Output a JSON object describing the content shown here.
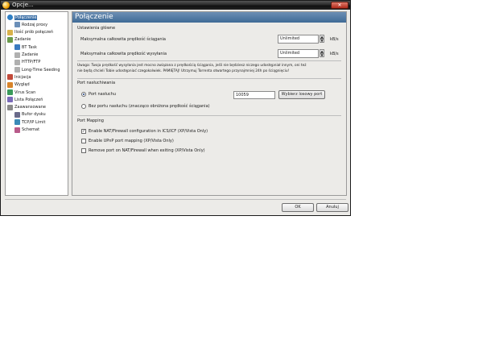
{
  "window": {
    "title": "Opcje...",
    "close_glyph": "✕"
  },
  "sidebar": {
    "items": [
      {
        "label": "Połączenie",
        "icon": "globe-icon",
        "indent": 0,
        "selected": true
      },
      {
        "label": "Rodzaj proxy",
        "icon": "proxy-icon",
        "indent": 1
      },
      {
        "label": "Ilość prób połączeń",
        "icon": "folder-icon",
        "indent": 0
      },
      {
        "label": "Zadanie",
        "icon": "task-icon",
        "indent": 0
      },
      {
        "label": "BT Task",
        "icon": "bt-task-icon",
        "indent": 1
      },
      {
        "label": "Zadanie",
        "icon": "page-icon",
        "indent": 1
      },
      {
        "label": "HTTP/FTP",
        "icon": "page-icon",
        "indent": 1
      },
      {
        "label": "Long-Time Seeding",
        "icon": "page-icon",
        "indent": 1
      },
      {
        "label": "Inicjacja",
        "icon": "init-icon",
        "indent": 0
      },
      {
        "label": "Wygląd",
        "icon": "appearance-icon",
        "indent": 0
      },
      {
        "label": "Virus Scan",
        "icon": "shield-icon",
        "indent": 0
      },
      {
        "label": "Lista Połączeń",
        "icon": "list-icon",
        "indent": 0
      },
      {
        "label": "Zaawansowane",
        "icon": "advanced-icon",
        "indent": 0
      },
      {
        "label": "Bufor dysku",
        "icon": "disk-icon",
        "indent": 1
      },
      {
        "label": "TCP/IP Limit",
        "icon": "network-icon",
        "indent": 1
      },
      {
        "label": "Schemat",
        "icon": "schema-icon",
        "indent": 1
      }
    ]
  },
  "panel": {
    "title": "Połączenie",
    "general": {
      "title": "Ustawienia główne",
      "download_label": "Maksymalna całkowita prędkość ściągania",
      "download_value": "Unlimited",
      "upload_label": "Maksymalna całkowita prędkość wysyłania",
      "upload_value": "Unlimited",
      "unit": "kB/s",
      "note_line1": "Uwaga: Twoja prędkość wysyłania jest mocno związana z prędkością ściągania, jeśli nie będziesz niczego udostępniał innym, oni też",
      "note_line2": "nie będą chcieli Tobie udostępniać czegokolwiek. PAMIĘTAJ! Utrzymuj Torrenta otwartego przynajmniej 24h po ściągnięciu!"
    },
    "listen": {
      "title": "Port nasłuchiwania",
      "port_label": "Port nasłuchu",
      "port_value": "10059",
      "random_button": "Wybierz losowy port",
      "no_port_label": "Bez portu nasłuchu (znacząco obniżona prędkość ściągania)"
    },
    "mapping": {
      "title": "Port Mapping",
      "check1": "Enable NAT/Firewall configuration in ICS/ICF (XP/Vista Only)",
      "check1_checked": true,
      "check2": "Enable UPnP port mapping (XP/Vista Only)",
      "check2_checked": false,
      "check3": "Remove port on NAT/Firewall when exiting (XP/Vista Only)",
      "check3_checked": false
    }
  },
  "buttons": {
    "ok": "OK",
    "cancel": "Anuluj"
  },
  "colors": {
    "selection": "#3a6ea5",
    "header": "#4f78a3"
  }
}
